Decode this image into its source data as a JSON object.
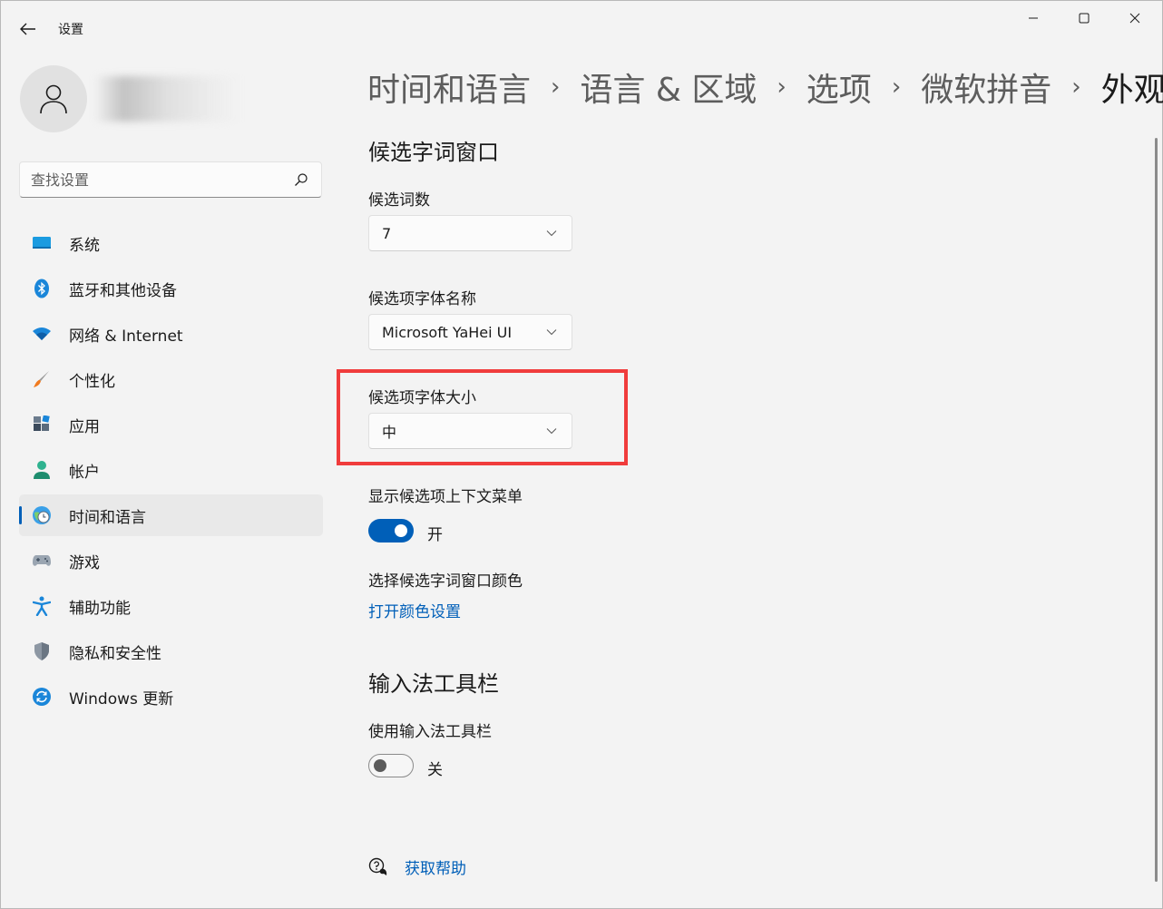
{
  "window": {
    "title": "设置"
  },
  "sidebar": {
    "search_placeholder": "查找设置",
    "items": [
      {
        "label": "系统",
        "icon": "monitor-icon",
        "active": false
      },
      {
        "label": "蓝牙和其他设备",
        "icon": "bluetooth-icon",
        "active": false
      },
      {
        "label": "网络 & Internet",
        "icon": "wifi-icon",
        "active": false
      },
      {
        "label": "个性化",
        "icon": "brush-icon",
        "active": false
      },
      {
        "label": "应用",
        "icon": "apps-icon",
        "active": false
      },
      {
        "label": "帐户",
        "icon": "account-icon",
        "active": false
      },
      {
        "label": "时间和语言",
        "icon": "globe-clock-icon",
        "active": true
      },
      {
        "label": "游戏",
        "icon": "gamepad-icon",
        "active": false
      },
      {
        "label": "辅助功能",
        "icon": "accessibility-icon",
        "active": false
      },
      {
        "label": "隐私和安全性",
        "icon": "shield-icon",
        "active": false
      },
      {
        "label": "Windows 更新",
        "icon": "update-icon",
        "active": false
      }
    ]
  },
  "breadcrumb": [
    "时间和语言",
    "语言 & 区域",
    "选项",
    "微软拼音",
    "外观"
  ],
  "breadcrumb_separator": "›",
  "candidate_window": {
    "title": "候选字词窗口",
    "count_label": "候选词数",
    "count_value": "7",
    "font_name_label": "候选项字体名称",
    "font_name_value": "Microsoft YaHei UI",
    "font_size_label": "候选项字体大小",
    "font_size_value": "中",
    "context_menu_label": "显示候选项上下文菜单",
    "context_menu_state": "开",
    "context_menu_on": true,
    "color_label": "选择候选字词窗口颜色",
    "color_link": "打开颜色设置"
  },
  "toolbar_section": {
    "title": "输入法工具栏",
    "use_label": "使用输入法工具栏",
    "use_state": "关",
    "use_on": false
  },
  "help": {
    "link": "获取帮助"
  },
  "colors": {
    "accent": "#005fb8",
    "highlight": "#f03c3c",
    "background": "#f3f3f3"
  }
}
